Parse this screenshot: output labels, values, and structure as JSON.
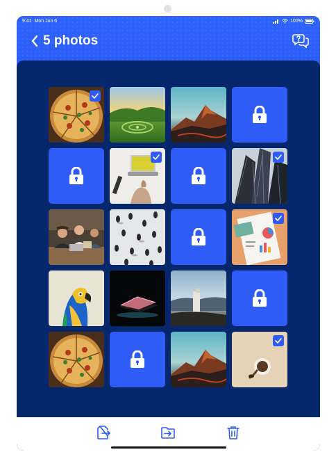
{
  "status_bar": {
    "time": "9:41",
    "date": "Mon Jun 6",
    "battery": "100%"
  },
  "header": {
    "back_label": "5 photos",
    "accent": "#2f5cf7"
  },
  "grid": {
    "tiles": [
      {
        "kind": "photo",
        "subject": "pizza",
        "selected": true
      },
      {
        "kind": "photo",
        "subject": "green-hills",
        "selected": false
      },
      {
        "kind": "photo",
        "subject": "red-mountain",
        "selected": false
      },
      {
        "kind": "locked"
      },
      {
        "kind": "locked"
      },
      {
        "kind": "photo",
        "subject": "laptop-desk",
        "selected": true
      },
      {
        "kind": "locked"
      },
      {
        "kind": "photo",
        "subject": "skyscrapers",
        "selected": true
      },
      {
        "kind": "photo",
        "subject": "people-meeting",
        "selected": false
      },
      {
        "kind": "photo",
        "subject": "crowd-aerial",
        "selected": false
      },
      {
        "kind": "locked"
      },
      {
        "kind": "photo",
        "subject": "charts-papers",
        "selected": true
      },
      {
        "kind": "photo",
        "subject": "parrot",
        "selected": false
      },
      {
        "kind": "photo",
        "subject": "dark-laptop",
        "selected": false
      },
      {
        "kind": "photo",
        "subject": "landscape-tower",
        "selected": false
      },
      {
        "kind": "locked"
      },
      {
        "kind": "photo",
        "subject": "pizza",
        "selected": false
      },
      {
        "kind": "locked"
      },
      {
        "kind": "photo",
        "subject": "red-mountain",
        "selected": false
      },
      {
        "kind": "photo",
        "subject": "coffee-cup",
        "selected": true
      }
    ]
  },
  "toolbar": {
    "icons": [
      "export-icon",
      "move-to-folder-icon",
      "trash-icon"
    ]
  }
}
